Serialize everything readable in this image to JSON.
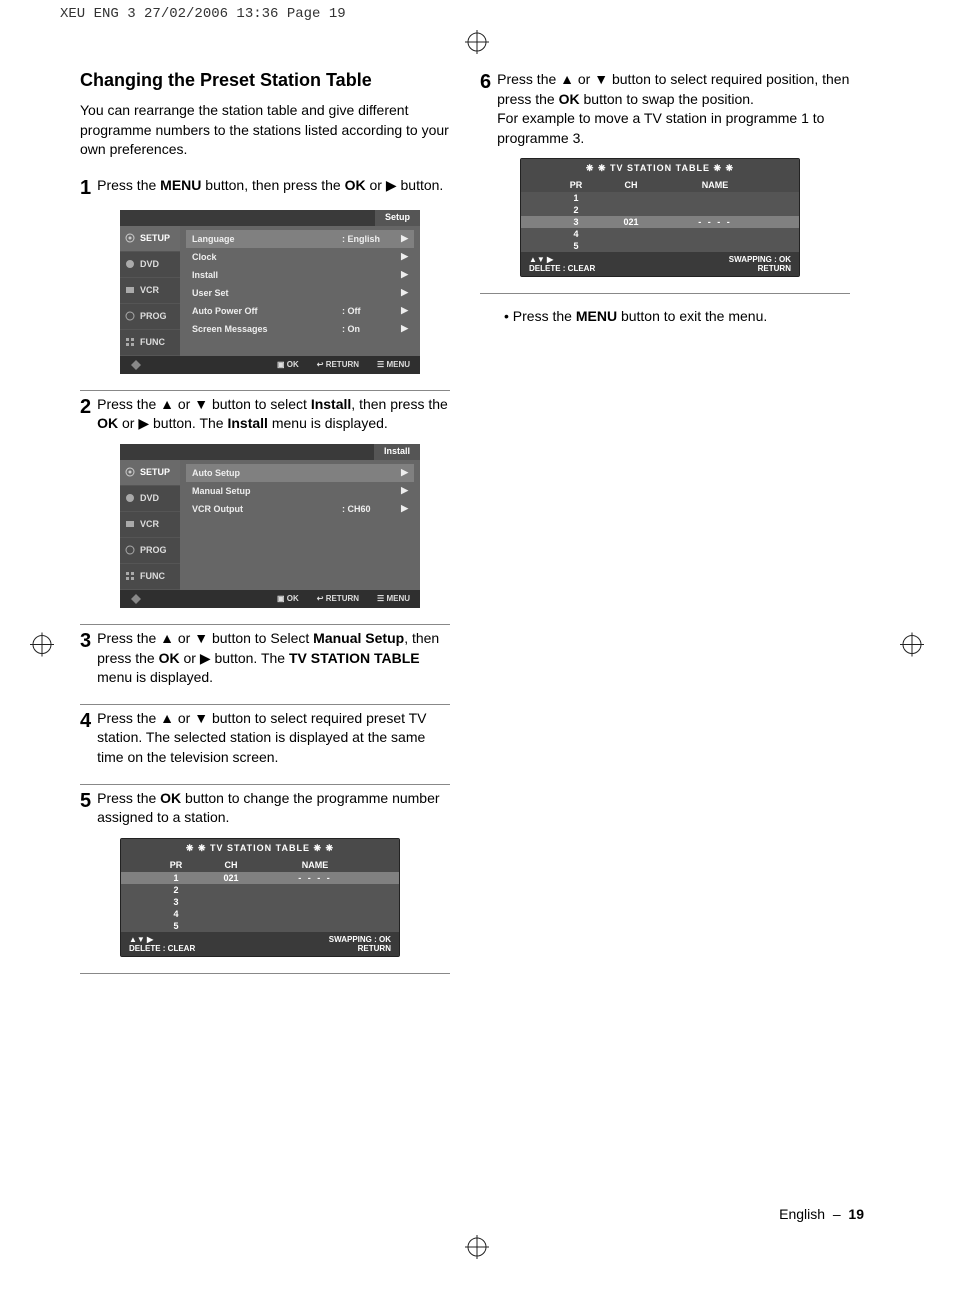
{
  "print_header": "XEU ENG 3   27/02/2006  13:36  Page 19",
  "section": {
    "title": "Changing the Preset Station Table",
    "intro": "You can rearrange the station table and give different programme numbers to the stations listed according to your own preferences."
  },
  "steps": {
    "s1": "Press the MENU button, then press the OK or ▶ button.",
    "s2": "Press the ▲ or ▼ button to select Install, then press the OK or ▶ button. The Install menu is displayed.",
    "s3": "Press the ▲ or ▼ button to Select Manual Setup, then press the OK or ▶ button. The TV STATION TABLE menu is displayed.",
    "s4": "Press the ▲ or ▼ button to select required preset TV station. The selected station is displayed at the same time on the television screen.",
    "s5": "Press the OK button to change the programme number assigned to a station.",
    "s6": "Press the ▲ or ▼ button to select required position, then press the OK button to swap the position. For example to move a TV station in programme 1 to programme 3.",
    "bullet": "• Press the MENU button to exit the menu."
  },
  "osd_setup": {
    "title": "Setup",
    "tabs": [
      "SETUP",
      "DVD",
      "VCR",
      "PROG",
      "FUNC"
    ],
    "rows": [
      {
        "name": "Language",
        "val": ": English",
        "hl": true
      },
      {
        "name": "Clock",
        "val": "",
        "hl": false
      },
      {
        "name": "Install",
        "val": "",
        "hl": false
      },
      {
        "name": "User Set",
        "val": "",
        "hl": false
      },
      {
        "name": "Auto Power Off",
        "val": ": Off",
        "hl": false
      },
      {
        "name": "Screen Messages",
        "val": ": On",
        "hl": false
      }
    ],
    "footer": {
      "ok": "OK",
      "ret": "RETURN",
      "menu": "MENU"
    }
  },
  "osd_install": {
    "title": "Install",
    "tabs": [
      "SETUP",
      "DVD",
      "VCR",
      "PROG",
      "FUNC"
    ],
    "rows": [
      {
        "name": "Auto Setup",
        "val": "",
        "hl": true
      },
      {
        "name": "Manual Setup",
        "val": "",
        "hl": false
      },
      {
        "name": "VCR Output",
        "val": ": CH60",
        "hl": false
      }
    ],
    "footer": {
      "ok": "OK",
      "ret": "RETURN",
      "menu": "MENU"
    }
  },
  "tst": {
    "title": "❋ ❋   TV STATION TABLE   ❋ ❋",
    "cols": {
      "pr": "PR",
      "ch": "CH",
      "name": "NAME"
    },
    "footer_left": "▲▼  ▶",
    "footer_left2": "DELETE : CLEAR",
    "footer_right": "SWAPPING  : OK",
    "footer_right2": "RETURN"
  },
  "tst1_rows": [
    {
      "pr": "1",
      "ch": "021",
      "name": "- - - -",
      "hl": true
    },
    {
      "pr": "2",
      "ch": "",
      "name": "",
      "hl": false
    },
    {
      "pr": "3",
      "ch": "",
      "name": "",
      "hl": false
    },
    {
      "pr": "4",
      "ch": "",
      "name": "",
      "hl": false
    },
    {
      "pr": "5",
      "ch": "",
      "name": "",
      "hl": false
    }
  ],
  "tst2_rows": [
    {
      "pr": "1",
      "ch": "",
      "name": "",
      "hl": false
    },
    {
      "pr": "2",
      "ch": "",
      "name": "",
      "hl": false
    },
    {
      "pr": "3",
      "ch": "021",
      "name": "- - - -",
      "hl": true
    },
    {
      "pr": "4",
      "ch": "",
      "name": "",
      "hl": false
    },
    {
      "pr": "5",
      "ch": "",
      "name": "",
      "hl": false
    }
  ],
  "footer": {
    "lang": "English",
    "dash": "–",
    "page": "19"
  }
}
